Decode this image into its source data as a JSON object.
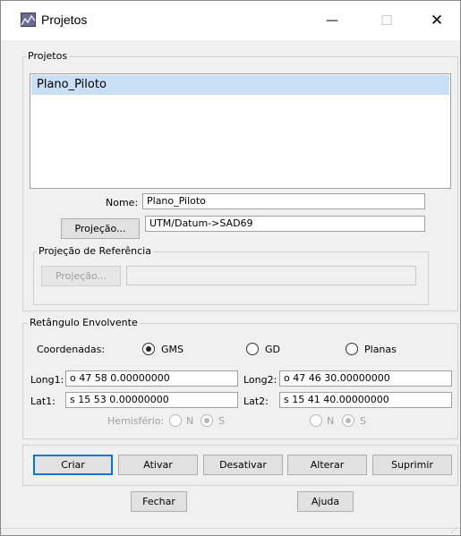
{
  "window": {
    "title": "Projetos",
    "controls": {
      "minimize": "—",
      "maximize": "☐",
      "close": "✕"
    }
  },
  "projetos": {
    "group_label": "Projetos",
    "list": [
      "Plano_Piloto"
    ],
    "nome_label": "Nome:",
    "nome_value": "Plano_Piloto",
    "projecao_button": "Projeção...",
    "projecao_value": "UTM/Datum->SAD69"
  },
  "referencia": {
    "group_label": "Projeção de Referência",
    "projecao_button": "Projeção...",
    "projecao_value": ""
  },
  "retangulo": {
    "group_label": "Retângulo Envolvente",
    "coordenadas_label": "Coordenadas:",
    "options": [
      {
        "label": "GMS",
        "checked": true
      },
      {
        "label": "GD",
        "checked": false
      },
      {
        "label": "Planas",
        "checked": false
      }
    ],
    "long1_label": "Long1:",
    "long1_value": "o 47 58 0.00000000",
    "long2_label": "Long2:",
    "long2_value": "o 47 46 30.00000000",
    "lat1_label": "Lat1:",
    "lat1_value": "s 15 53 0.00000000",
    "lat2_label": "Lat2:",
    "lat2_value": "s 15 41 40.00000000",
    "hemisferio_label": "Hemisfério:",
    "hemisferio1": {
      "n": "N",
      "s": "S",
      "selected": "S"
    },
    "hemisferio2": {
      "n": "N",
      "s": "S",
      "selected": "S"
    }
  },
  "actions": {
    "criar": "Criar",
    "ativar": "Ativar",
    "desativar": "Desativar",
    "alterar": "Alterar",
    "suprimir": "Suprimir",
    "fechar": "Fechar",
    "ajuda": "Ajuda"
  }
}
